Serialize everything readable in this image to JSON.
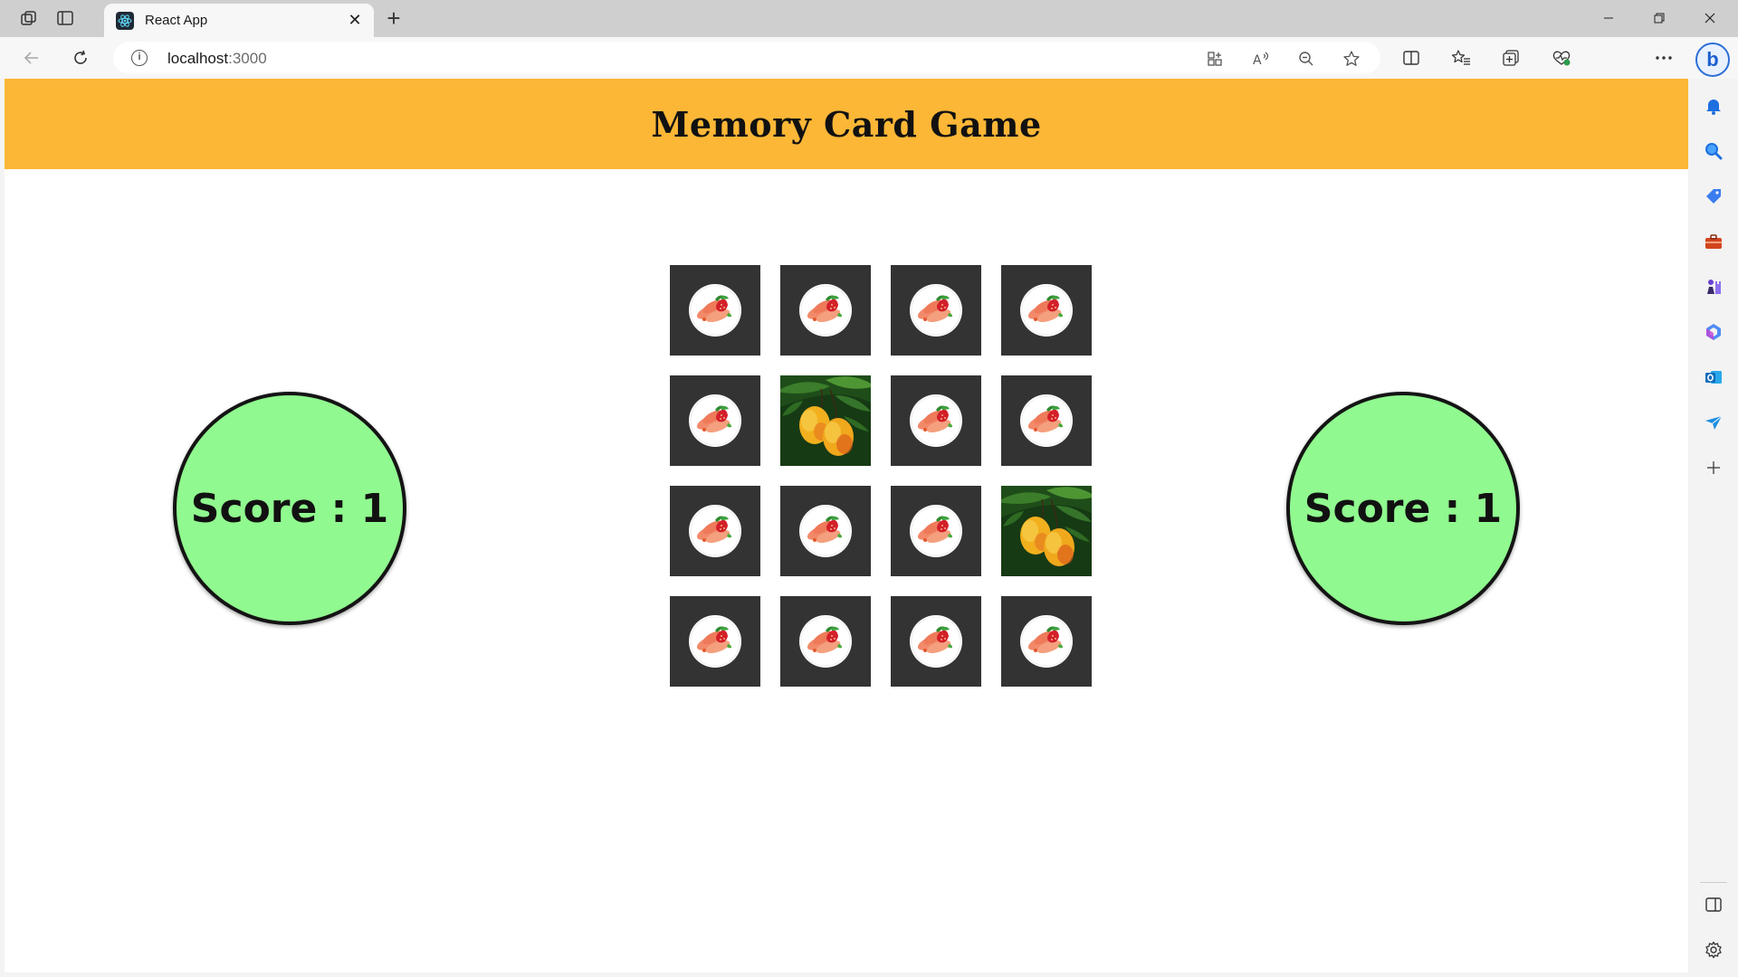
{
  "browser": {
    "tab_title": "React App",
    "tab_close": "✕",
    "new_tab": "+",
    "address_host": "localhost",
    "address_port": ":3000",
    "profile_color": "#2a0508"
  },
  "app": {
    "title": "Memory Card Game",
    "header_color": "#fcb737",
    "score_color": "#90f98f",
    "card_color": "#333333"
  },
  "scores": [
    {
      "label": "Score : 1"
    },
    {
      "label": "Score : 1"
    }
  ],
  "cards": [
    {
      "state": "hidden",
      "icon": "fruit-plate-icon"
    },
    {
      "state": "hidden",
      "icon": "fruit-plate-icon"
    },
    {
      "state": "hidden",
      "icon": "fruit-plate-icon"
    },
    {
      "state": "hidden",
      "icon": "fruit-plate-icon"
    },
    {
      "state": "hidden",
      "icon": "fruit-plate-icon"
    },
    {
      "state": "revealed",
      "icon": "mango-icon"
    },
    {
      "state": "hidden",
      "icon": "fruit-plate-icon"
    },
    {
      "state": "hidden",
      "icon": "fruit-plate-icon"
    },
    {
      "state": "hidden",
      "icon": "fruit-plate-icon"
    },
    {
      "state": "hidden",
      "icon": "fruit-plate-icon"
    },
    {
      "state": "hidden",
      "icon": "fruit-plate-icon"
    },
    {
      "state": "revealed",
      "icon": "mango-icon"
    },
    {
      "state": "hidden",
      "icon": "fruit-plate-icon"
    },
    {
      "state": "hidden",
      "icon": "fruit-plate-icon"
    },
    {
      "state": "hidden",
      "icon": "fruit-plate-icon"
    },
    {
      "state": "hidden",
      "icon": "fruit-plate-icon"
    }
  ]
}
